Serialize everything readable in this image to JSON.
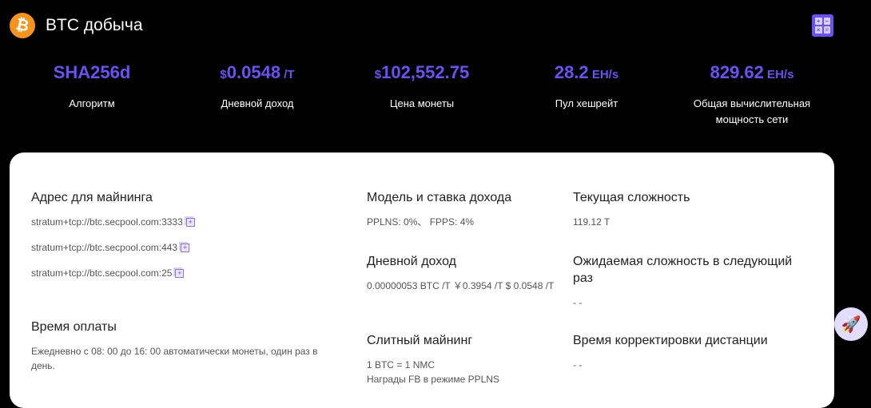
{
  "header": {
    "title": "BTC добыча",
    "logo_symbol": "₿"
  },
  "stats": [
    {
      "prefix": "",
      "value": "SHA256d",
      "suffix": "",
      "label": "Алгоритм"
    },
    {
      "prefix": "$",
      "value": "0.0548",
      "suffix": " /T",
      "label": "Дневной доход"
    },
    {
      "prefix": "$",
      "value": "102,552.75",
      "suffix": "",
      "label": "Цена монеты"
    },
    {
      "prefix": "",
      "value": "28.2",
      "suffix": " EH/s",
      "label": "Пул хешрейт"
    },
    {
      "prefix": "",
      "value": "829.62",
      "suffix": " EH/s",
      "label": "Общая вычислительная мощность сети"
    }
  ],
  "mining": {
    "title": "Адрес для майнинга",
    "addresses": [
      "stratum+tcp://btc.secpool.com:3333",
      "stratum+tcp://btc.secpool.com:443",
      "stratum+tcp://btc.secpool.com:25"
    ]
  },
  "payment": {
    "title": "Время оплаты",
    "text": "Ежедневно с 08: 00 до 16: 00 автоматически монеты, один раз в день."
  },
  "model": {
    "title": "Модель и ставка дохода",
    "text": "PPLNS: 0%、 FPPS: 4%"
  },
  "daily": {
    "title": "Дневной доход",
    "text": "0.00000053 BTC /T ￥0.3954 /T $ 0.0548 /T"
  },
  "merged": {
    "title": "Слитный майнинг",
    "line1": "1 BTC = 1 NMC",
    "line2": "Награды FB в режиме PPLNS"
  },
  "difficulty": {
    "title": "Текущая сложность",
    "text": "119.12 T"
  },
  "next_difficulty": {
    "title": "Ожидаемая сложность в следующий раз",
    "text": "- -"
  },
  "adjust": {
    "title": "Время корректировки дистанции",
    "text": "- -"
  }
}
